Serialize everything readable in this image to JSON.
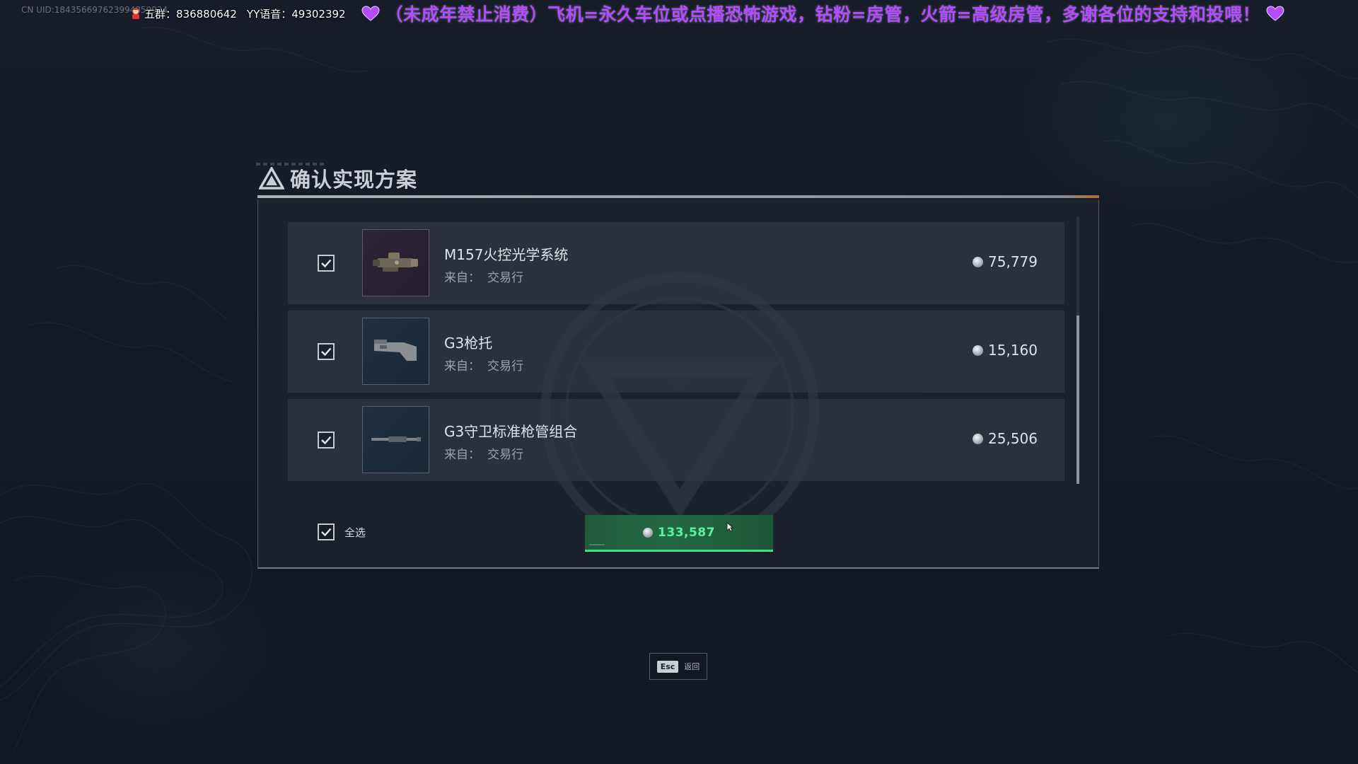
{
  "overlay": {
    "uid_text": "CN UID:184356697623994859924",
    "group_text": "五群：836880642",
    "yy_text": "YY语音：49302392",
    "notice_text": "（未成年禁止消费）飞机=永久车位或点播恐怖游戏，钻粉=房管，火箭=高级房管，多谢各位的支持和投喂！",
    "accent_color": "#b34bff"
  },
  "dialog": {
    "title": "确认实现方案",
    "items": [
      {
        "name": "M157火控光学系统",
        "source_label": "来自：",
        "source_value": "交易行",
        "price": "75,779",
        "checked": true,
        "thumb_icon": "scope-icon",
        "thumb_bg": "purple"
      },
      {
        "name": "G3枪托",
        "source_label": "来自：",
        "source_value": "交易行",
        "price": "15,160",
        "checked": true,
        "thumb_icon": "stock-icon",
        "thumb_bg": "blue"
      },
      {
        "name": "G3守卫标准枪管组合",
        "source_label": "来自：",
        "source_value": "交易行",
        "price": "25,506",
        "checked": true,
        "thumb_icon": "barrel-icon",
        "thumb_bg": "blue"
      }
    ],
    "select_all": {
      "label": "全选",
      "checked": true
    },
    "confirm": {
      "total": "133,587",
      "accent_color": "#3fe08a"
    }
  },
  "esc_hint": {
    "key": "Esc",
    "label": "返回"
  }
}
